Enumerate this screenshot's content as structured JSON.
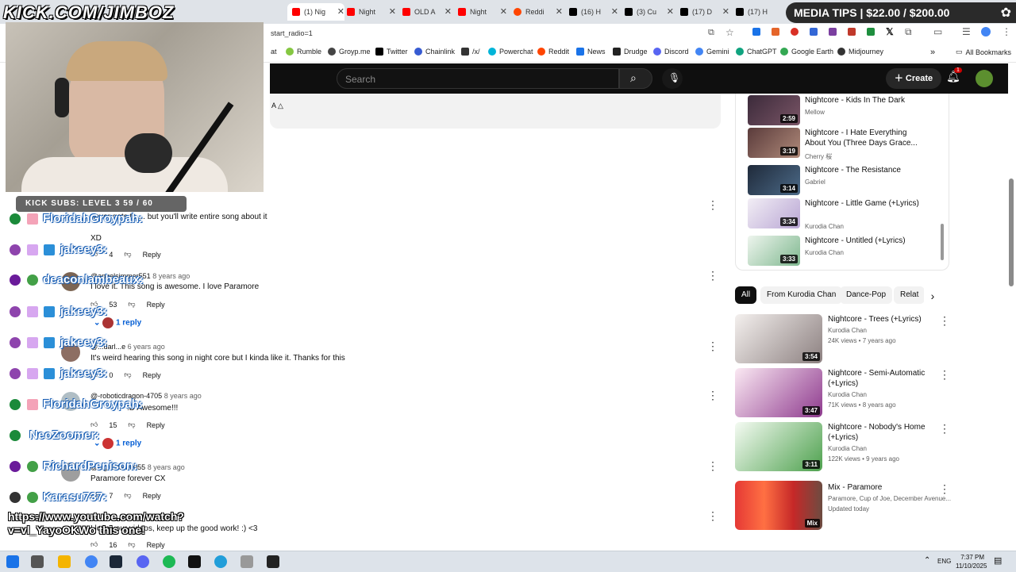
{
  "browser": {
    "tabs": [
      {
        "label": "(1) Nig",
        "color": "#ff0000",
        "active": true
      },
      {
        "label": "Night",
        "color": "#ff0000"
      },
      {
        "label": "OLD A",
        "color": "#ff0000"
      },
      {
        "label": "Night",
        "color": "#ff0000"
      },
      {
        "label": "Reddi",
        "color": "#ff4500"
      },
      {
        "label": "(16) H",
        "color": "#000000"
      },
      {
        "label": "(3) Cu",
        "color": "#000000"
      },
      {
        "label": "(17) D",
        "color": "#000000"
      },
      {
        "label": "(17) H",
        "color": "#000000"
      }
    ],
    "address": "start_radio=1",
    "bookmarks": [
      {
        "label": "at",
        "color": "#888888"
      },
      {
        "label": "Rumble",
        "color": "#85c742"
      },
      {
        "label": "Groyp.me",
        "color": "#444444"
      },
      {
        "label": "Twitter",
        "color": "#000000"
      },
      {
        "label": "Chainlink",
        "color": "#375bd2"
      },
      {
        "label": "/x/",
        "color": "#333333"
      },
      {
        "label": "Powerchat",
        "color": "#00b4d8"
      },
      {
        "label": "Reddit",
        "color": "#ff4500"
      },
      {
        "label": "News",
        "color": "#1a73e8"
      },
      {
        "label": "Drudge",
        "color": "#222222"
      },
      {
        "label": "Discord",
        "color": "#5865f2"
      },
      {
        "label": "Gemini",
        "color": "#4285f4"
      },
      {
        "label": "ChatGPT",
        "color": "#10a37f"
      },
      {
        "label": "Google Earth",
        "color": "#34a853"
      },
      {
        "label": "Midjourney",
        "color": "#333333"
      }
    ],
    "all_bookmarks": "All Bookmarks"
  },
  "stream_overlay": {
    "watermark": "KICK.COM/JIMBOZ",
    "media_tips": "MEDIA TIPS | $22.00 / $200.00",
    "kick_subs": "KICK SUBS: LEVEL 3 59 / 60",
    "chat": [
      {
        "name": "FloridahGroypah:",
        "text": ""
      },
      {
        "name": "jakeey3:",
        "text": ""
      },
      {
        "name": "deaconlambeaux:",
        "text": ""
      },
      {
        "name": "jakeey3:",
        "text": ""
      },
      {
        "name": "jakeey3:",
        "text": ""
      },
      {
        "name": "jakeey3:",
        "text": ""
      },
      {
        "name": "FloridahGroypah:",
        "text": ""
      },
      {
        "name": "NeoZoomer:",
        "text": ""
      },
      {
        "name": "RichardPenison:",
        "text": ""
      },
      {
        "name": "Karasu737:",
        "text": ""
      }
    ],
    "link_msg_1": "https://www.youtube.com/watch?",
    "link_msg_2": "v=vl_YayoOKWo this one!"
  },
  "youtube": {
    "search_placeholder": "Search",
    "create_label": "Create",
    "notif_count": "1",
    "comments": [
      {
        "author": "",
        "age": "",
        "text": "never gets to ... but you'll write entire song about it",
        "likes": "",
        "reply": "Reply"
      },
      {
        "author": "",
        "age": "",
        "text": "XD",
        "likes": "4",
        "reply": "Reply"
      },
      {
        "author": "@angelsimmer551",
        "age": "8 years ago",
        "text": "I love it. This song is awesome. I love Paramore",
        "likes": "53",
        "reply": "Reply",
        "replies": "1 reply"
      },
      {
        "author": "@...darl...e",
        "age": "6 years ago",
        "text": "It's weird hearing this song in night core but I kinda like it. Thanks for this",
        "likes": "0",
        "reply": "Reply"
      },
      {
        "author": "@-roboticdragon-4705",
        "age": "8 years ago",
        "text": ":D Awesome!!!",
        "likes": "15",
        "reply": "Reply",
        "replies": "1 reply"
      },
      {
        "author": "@nightmare6055",
        "age": "8 years ago",
        "text": "Paramore forever CX",
        "likes": "7",
        "reply": "Reply"
      },
      {
        "author": "",
        "age": "",
        "text": "I love your videos, keep up the good work! :) <3",
        "likes": "16",
        "reply": "Reply"
      }
    ],
    "playlist": [
      {
        "title": "Nightcore - Kids In The Dark",
        "channel": "Mellow",
        "dur": "2:59"
      },
      {
        "title": "Nightcore - I Hate Everything About You (Three Days Grace...",
        "channel": "Cherry 桜",
        "dur": "3:19"
      },
      {
        "title": "Nightcore - The Resistance",
        "channel": "Gabriel",
        "dur": "3:14"
      },
      {
        "title": "Nightcore - Little Game (+Lyrics)",
        "channel": "Kurodia Chan",
        "dur": "3:34"
      },
      {
        "title": "Nightcore - Untitled (+Lyrics)",
        "channel": "Kurodia Chan",
        "dur": "3:33"
      }
    ],
    "chips": [
      "All",
      "From Kurodia Chan",
      "Dance-Pop",
      "Relat"
    ],
    "recs": [
      {
        "title": "Nightcore - Trees (+Lyrics)",
        "channel": "Kurodia Chan",
        "meta": "24K views • 7 years ago",
        "dur": "3:54"
      },
      {
        "title": "Nightcore - Semi-Automatic (+Lyrics)",
        "channel": "Kurodia Chan",
        "meta": "71K views • 8 years ago",
        "dur": "3:47"
      },
      {
        "title": "Nightcore - Nobody's Home (+Lyrics)",
        "channel": "Kurodia Chan",
        "meta": "122K views • 9 years ago",
        "dur": "3:11"
      },
      {
        "title": "Mix - Paramore",
        "channel": "Paramore, Cup of Joe, December Avenue...",
        "meta": "Updated today",
        "dur": "Mix"
      }
    ]
  },
  "taskbar": {
    "lang": "ENG",
    "time": "7:37 PM",
    "date": "11/10/2025"
  }
}
